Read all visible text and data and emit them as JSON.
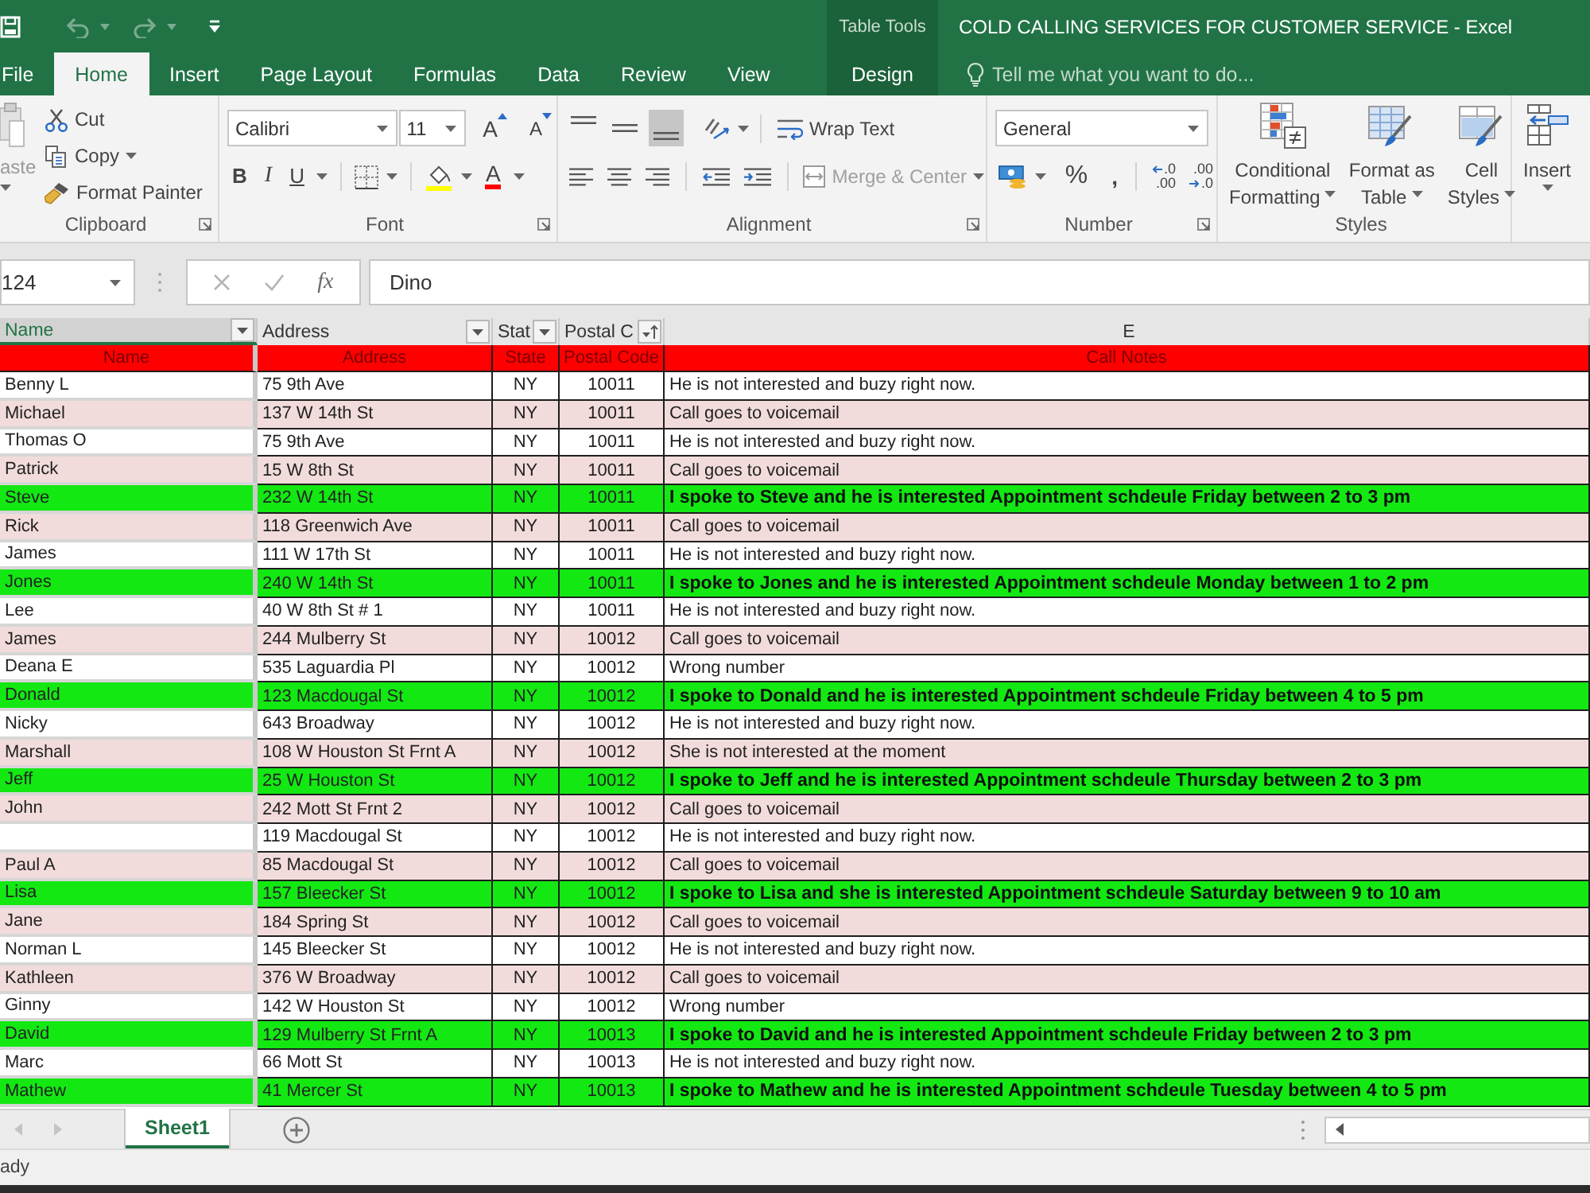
{
  "quick_access": [
    {
      "kind": "save",
      "disabled": false
    },
    {
      "kind": "undo",
      "disabled": true
    },
    {
      "kind": "redo",
      "disabled": true
    },
    {
      "kind": "customize",
      "disabled": false
    }
  ],
  "title_bar": {
    "contextual_tab_group": "Table Tools",
    "title": "COLD CALLING SERVICES FOR CUSTOMER SERVICE - Excel"
  },
  "tabs": [
    {
      "label": "File",
      "kind": "standard",
      "selected": false
    },
    {
      "label": "Home",
      "kind": "standard",
      "selected": true
    },
    {
      "label": "Insert",
      "kind": "standard",
      "selected": false
    },
    {
      "label": "Page Layout",
      "kind": "standard",
      "selected": false
    },
    {
      "label": "Formulas",
      "kind": "standard",
      "selected": false
    },
    {
      "label": "Data",
      "kind": "standard",
      "selected": false
    },
    {
      "label": "Review",
      "kind": "standard",
      "selected": false
    },
    {
      "label": "View",
      "kind": "standard",
      "selected": false
    },
    {
      "label": "Design",
      "kind": "contextual",
      "selected": false
    }
  ],
  "tell_me": {
    "placeholder": "Tell me what you want to do..."
  },
  "ribbon": {
    "clipboard": {
      "paste": "aste",
      "cut": "Cut",
      "copy": "Copy",
      "format_painter": "Format Painter",
      "label": "Clipboard"
    },
    "font": {
      "font_name": "Calibri",
      "font_size": "11",
      "grow": "A",
      "shrink": "A",
      "bold": "B",
      "italic": "I",
      "underline": "U",
      "font_color": "A",
      "label": "Font"
    },
    "alignment": {
      "vertical_align": [
        {
          "kind": "top",
          "selected": false
        },
        {
          "kind": "middle",
          "selected": false
        },
        {
          "kind": "bottom",
          "selected": true
        }
      ],
      "wrap_text": "Wrap Text",
      "merge_center": {
        "label": "Merge & Center",
        "disabled": true
      },
      "label": "Alignment"
    },
    "number": {
      "format": "General",
      "percent": "%",
      "comma": ",",
      "increase_decimal": {
        "top": ".0",
        "bottom": ".00"
      },
      "decrease_decimal": {
        "top": ".00",
        "bottom": ".0"
      },
      "label": "Number"
    },
    "styles": {
      "buttons": [
        {
          "kind": "conditional",
          "lines": [
            "Conditional",
            "Formatting"
          ]
        },
        {
          "kind": "table",
          "lines": [
            "Format as",
            "Table"
          ]
        },
        {
          "kind": "cell",
          "lines": [
            "Cell",
            "Styles"
          ]
        }
      ],
      "label": "Styles"
    },
    "cells": {
      "insert": "Insert"
    }
  },
  "formula_bar": {
    "name_box": "124",
    "fx": "fx",
    "value": "Dino"
  },
  "column_headers": [
    {
      "label": "Name",
      "kind": "filter",
      "selected": true
    },
    {
      "label": "Address",
      "kind": "filter",
      "selected": false
    },
    {
      "label": "Stat",
      "kind": "filter",
      "selected": false
    },
    {
      "label": "Postal C",
      "kind": "sorted",
      "selected": false
    },
    {
      "label": "E",
      "kind": "plain",
      "selected": false
    }
  ],
  "table": {
    "columns": [
      "Name",
      "Address",
      "State",
      "Postal Code",
      "Call Notes"
    ],
    "rows": [
      {
        "name": "Benny L",
        "address": "75 9th Ave",
        "state": "NY",
        "postal_code": "10011",
        "notes": "He is not interested and buzy right now.",
        "color": "#ffffff",
        "kind": "note"
      },
      {
        "name": "Michael",
        "address": "137 W 14th St",
        "state": "NY",
        "postal_code": "10011",
        "notes": "Call goes to voicemail",
        "color": "#f2dcdb",
        "kind": "note"
      },
      {
        "name": "Thomas O",
        "address": "75 9th Ave",
        "state": "NY",
        "postal_code": "10011",
        "notes": "He is not interested and buzy right now.",
        "color": "#ffffff",
        "kind": "note"
      },
      {
        "name": "Patrick",
        "address": "15 W 8th St",
        "state": "NY",
        "postal_code": "10011",
        "notes": "Call goes to voicemail",
        "color": "#f2dcdb",
        "kind": "note"
      },
      {
        "name": "Steve",
        "address": "232 W 14th St",
        "state": "NY",
        "postal_code": "10011",
        "notes": "I spoke to Steve and he is interested Appointment schdeule Friday between 2 to 3 pm",
        "color": "#13e813",
        "kind": "appointment"
      },
      {
        "name": "Rick",
        "address": "118 Greenwich Ave",
        "state": "NY",
        "postal_code": "10011",
        "notes": "Call goes to voicemail",
        "color": "#f2dcdb",
        "kind": "note"
      },
      {
        "name": "James",
        "address": "111 W 17th St",
        "state": "NY",
        "postal_code": "10011",
        "notes": "He is not interested and buzy right now.",
        "color": "#ffffff",
        "kind": "note"
      },
      {
        "name": "Jones",
        "address": "240 W 14th St",
        "state": "NY",
        "postal_code": "10011",
        "notes": "I spoke to Jones and he is interested Appointment schdeule Monday between 1 to 2 pm",
        "color": "#13e813",
        "kind": "appointment"
      },
      {
        "name": "Lee",
        "address": "40 W 8th St # 1",
        "state": "NY",
        "postal_code": "10011",
        "notes": "He is not interested and buzy right now.",
        "color": "#ffffff",
        "kind": "note"
      },
      {
        "name": "James",
        "address": "244 Mulberry St",
        "state": "NY",
        "postal_code": "10012",
        "notes": "Call goes to voicemail",
        "color": "#f2dcdb",
        "kind": "note"
      },
      {
        "name": "Deana E",
        "address": "535 Laguardia Pl",
        "state": "NY",
        "postal_code": "10012",
        "notes": "Wrong number",
        "color": "#ffffff",
        "kind": "note"
      },
      {
        "name": "Donald",
        "address": "123 Macdougal St",
        "state": "NY",
        "postal_code": "10012",
        "notes": "I spoke to Donald and he is interested Appointment schdeule Friday between 4 to 5 pm",
        "color": "#13e813",
        "kind": "appointment"
      },
      {
        "name": "Nicky",
        "address": "643 Broadway",
        "state": "NY",
        "postal_code": "10012",
        "notes": "He is not interested and buzy right now.",
        "color": "#ffffff",
        "kind": "note"
      },
      {
        "name": "Marshall",
        "address": "108 W Houston St Frnt A",
        "state": "NY",
        "postal_code": "10012",
        "notes": "She is not interested at the moment",
        "color": "#f2dcdb",
        "kind": "note"
      },
      {
        "name": "Jeff",
        "address": "25 W Houston St",
        "state": "NY",
        "postal_code": "10012",
        "notes": "I spoke to Jeff and he is interested Appointment schdeule Thursday between 2 to 3 pm",
        "color": "#13e813",
        "kind": "appointment"
      },
      {
        "name": "John",
        "address": "242 Mott St Frnt 2",
        "state": "NY",
        "postal_code": "10012",
        "notes": "Call goes to voicemail",
        "color": "#f2dcdb",
        "kind": "note"
      },
      {
        "address": "119 Macdougal St",
        "state": "NY",
        "postal_code": "10012",
        "notes": "He is not interested and buzy right now.",
        "color": "#ffffff",
        "kind": "note"
      },
      {
        "name": "Paul A",
        "address": "85 Macdougal St",
        "state": "NY",
        "postal_code": "10012",
        "notes": "Call goes to voicemail",
        "color": "#f2dcdb",
        "kind": "note"
      },
      {
        "name": "Lisa",
        "address": "157 Bleecker St",
        "state": "NY",
        "postal_code": "10012",
        "notes": "I spoke to Lisa and she is interested Appointment schdeule Saturday between 9 to 10 am",
        "color": "#13e813",
        "kind": "appointment"
      },
      {
        "name": "Jane",
        "address": "184 Spring St",
        "state": "NY",
        "postal_code": "10012",
        "notes": "Call goes to voicemail",
        "color": "#f2dcdb",
        "kind": "note"
      },
      {
        "name": "Norman L",
        "address": "145 Bleecker St",
        "state": "NY",
        "postal_code": "10012",
        "notes": "He is not interested and buzy right now.",
        "color": "#ffffff",
        "kind": "note"
      },
      {
        "name": "Kathleen",
        "address": "376 W Broadway",
        "state": "NY",
        "postal_code": "10012",
        "notes": "Call goes to voicemail",
        "color": "#f2dcdb",
        "kind": "note"
      },
      {
        "name": "Ginny",
        "address": "142 W Houston St",
        "state": "NY",
        "postal_code": "10012",
        "notes": "Wrong number",
        "color": "#ffffff",
        "kind": "note"
      },
      {
        "name": "David",
        "address": "129 Mulberry St Frnt A",
        "state": "NY",
        "postal_code": "10013",
        "notes": "I spoke to David and he is interested Appointment schdeule Friday between 2 to 3 pm",
        "color": "#13e813",
        "kind": "appointment"
      },
      {
        "name": "Marc",
        "address": "66 Mott St",
        "state": "NY",
        "postal_code": "10013",
        "notes": "He is not interested and buzy right now.",
        "color": "#ffffff",
        "kind": "note"
      },
      {
        "name": "Mathew",
        "address": "41 Mercer St",
        "state": "NY",
        "postal_code": "10013",
        "notes": "I spoke to Mathew and he is interested Appointment schdeule Tuesday between 4 to 5 pm",
        "color": "#13e813",
        "kind": "appointment"
      }
    ]
  },
  "sheet_tabs": [
    {
      "label": "Sheet1",
      "selected": true
    }
  ],
  "status_bar": {
    "text": "ady"
  }
}
